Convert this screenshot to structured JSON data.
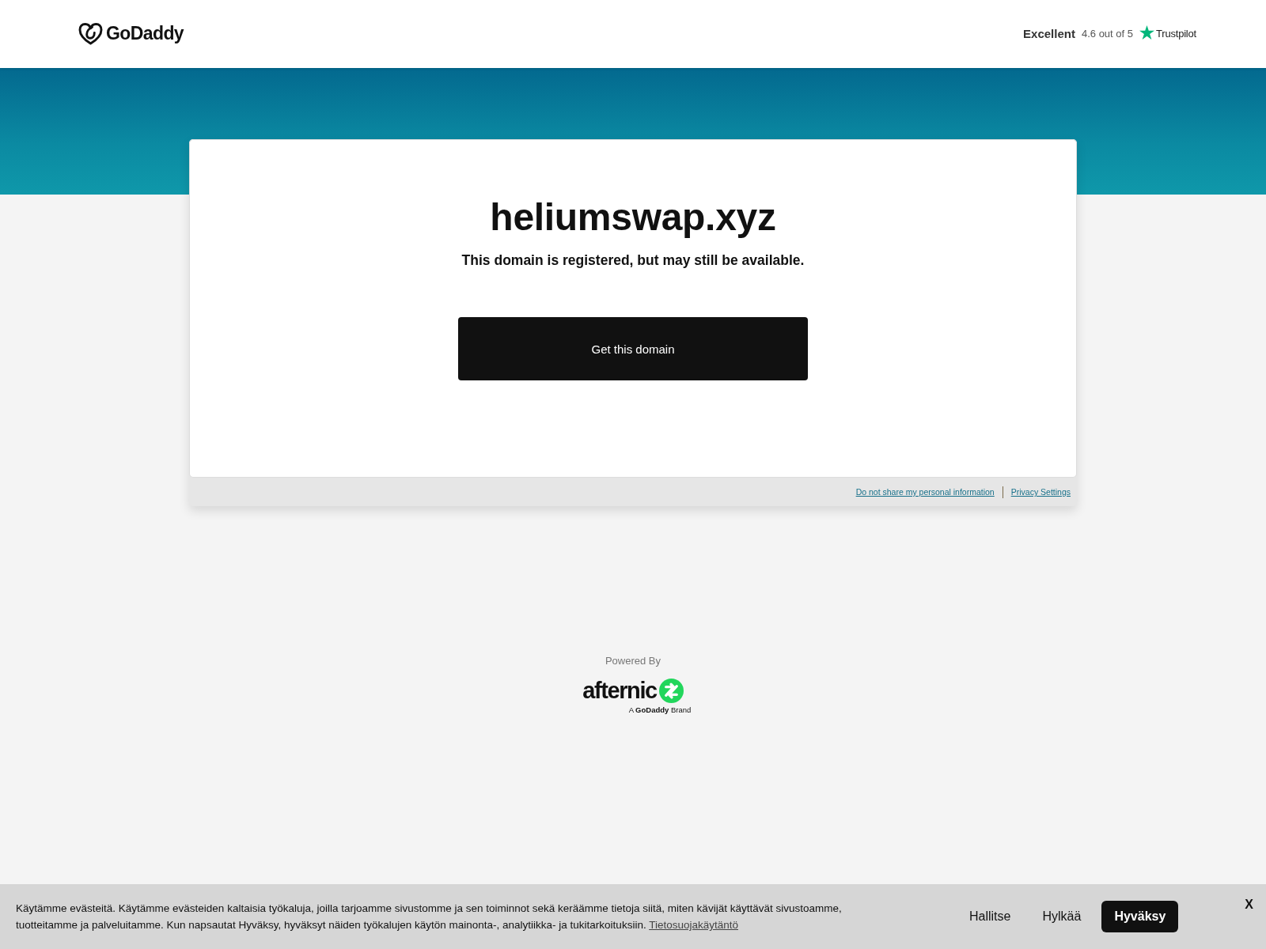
{
  "header": {
    "logo": {
      "text": "GoDaddy"
    },
    "rating": {
      "label": "Excellent",
      "score": "4.6 out of 5",
      "brand": "Trustpilot"
    }
  },
  "domain_card": {
    "domain": "heliumswap.xyz",
    "message": "This domain is registered, but may still be available.",
    "button": "Get this domain",
    "links": [
      "Do not share my personal information",
      "Privacy Settings"
    ]
  },
  "powered_by": {
    "label": "Powered By",
    "logo_text": "afternic",
    "tagline": "A **GoDaddy** Brand"
  },
  "cookie_banner": {
    "text": "Käytämme evästeitä. Käytämme evästeiden kaltaisia työkaluja, joilla tarjoamme sivustomme ja sen toiminnot sekä keräämme tietoja siitä, miten kävijät käyttävät sivustoamme, tuotteitamme ja palveluitamme. Kun napsautat Hyväksy, hyväksyt näiden työkalujen käytön mainonta-, analytiikka- ja tukitarkoituksiin.",
    "link": "Tietosuojakäytäntö",
    "buttons": [
      {
        "label": "Hallitse",
        "kind": "text"
      },
      {
        "label": "Hylkää",
        "kind": "text"
      },
      {
        "label": "Hyväksy",
        "kind": "primary"
      }
    ],
    "close": "X"
  }
}
